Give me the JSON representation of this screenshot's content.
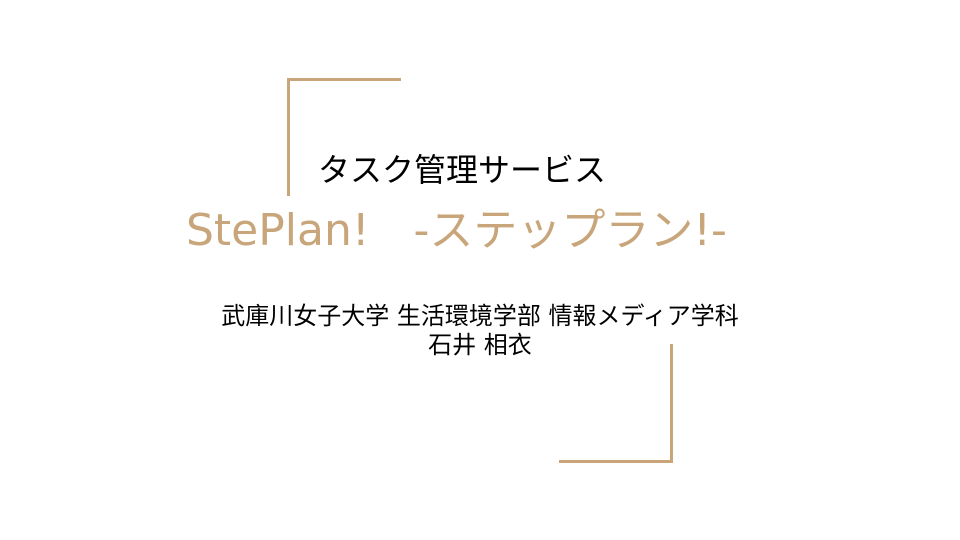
{
  "slide": {
    "subtitle": "タスク管理サービス",
    "title": "StePlan!　-ステップラン!-",
    "affiliation": "武庫川女子大学 生活環境学部 情報メディア学科",
    "author": "石井 相衣"
  },
  "colors": {
    "accent": "#c8a57a",
    "text": "#000000",
    "background": "#ffffff"
  }
}
